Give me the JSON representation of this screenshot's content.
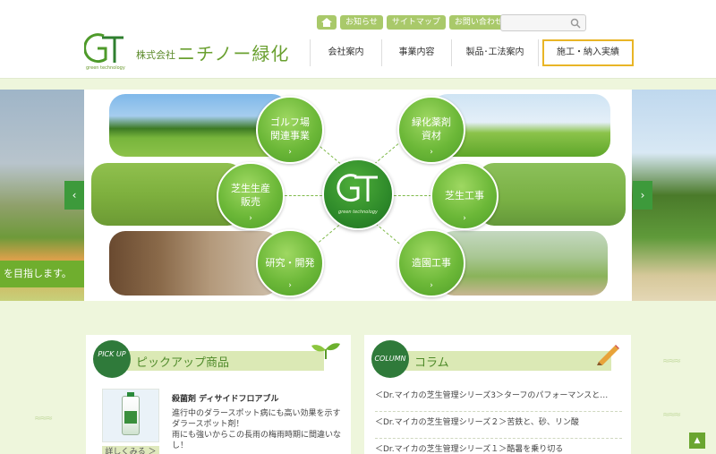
{
  "header": {
    "top_links": [
      "お知らせ",
      "サイトマップ",
      "お問い合わせ"
    ],
    "search_placeholder": "",
    "logo_sub": "green technology",
    "company_prefix": "株式会社",
    "company_name": "ニチノー緑化",
    "nav": [
      "会社案内",
      "事業内容",
      "製品･工法案内",
      "施工・納入実績"
    ]
  },
  "hero": {
    "left_banner": "を目指します。",
    "arrow_left": "‹",
    "arrow_right": "›",
    "hub_sub": "green technology",
    "bubbles": [
      {
        "line1": "ゴルフ場",
        "line2": "関連事業"
      },
      {
        "line1": "芝生生産",
        "line2": "販売"
      },
      {
        "line1": "研究・開発",
        "line2": ""
      },
      {
        "line1": "緑化薬剤",
        "line2": "資材"
      },
      {
        "line1": "芝生工事",
        "line2": ""
      },
      {
        "line1": "造園工事",
        "line2": ""
      }
    ],
    "go": "›"
  },
  "pickup": {
    "badge": "PICK UP",
    "title": "ピックアップ商品",
    "product_name": "殺菌剤 ディサイドフロアブル",
    "product_desc": "進行中のダラースポット病にも高い効果を示すダラースポット剤！\n雨にも強いからこの長雨の梅雨時期に間違いなし！",
    "more": "詳しくみる ＞"
  },
  "column": {
    "badge": "COLUMN",
    "title": "コラム",
    "items": [
      "＜Dr.マイカの芝生管理シリーズ3＞ターフのパフォーマンスと…",
      "＜Dr.マイカの芝生管理シリーズ２＞苦鉄と、砂、リン酸",
      "＜Dr.マイカの芝生管理シリーズ１＞酷暑を乗り切る"
    ]
  },
  "to_top": "▲",
  "squiggle": "≈≈≈",
  "colors": {
    "brand_green": "#6aa030",
    "accent_gold": "#e9b526",
    "button_green": "#a9c96a"
  }
}
